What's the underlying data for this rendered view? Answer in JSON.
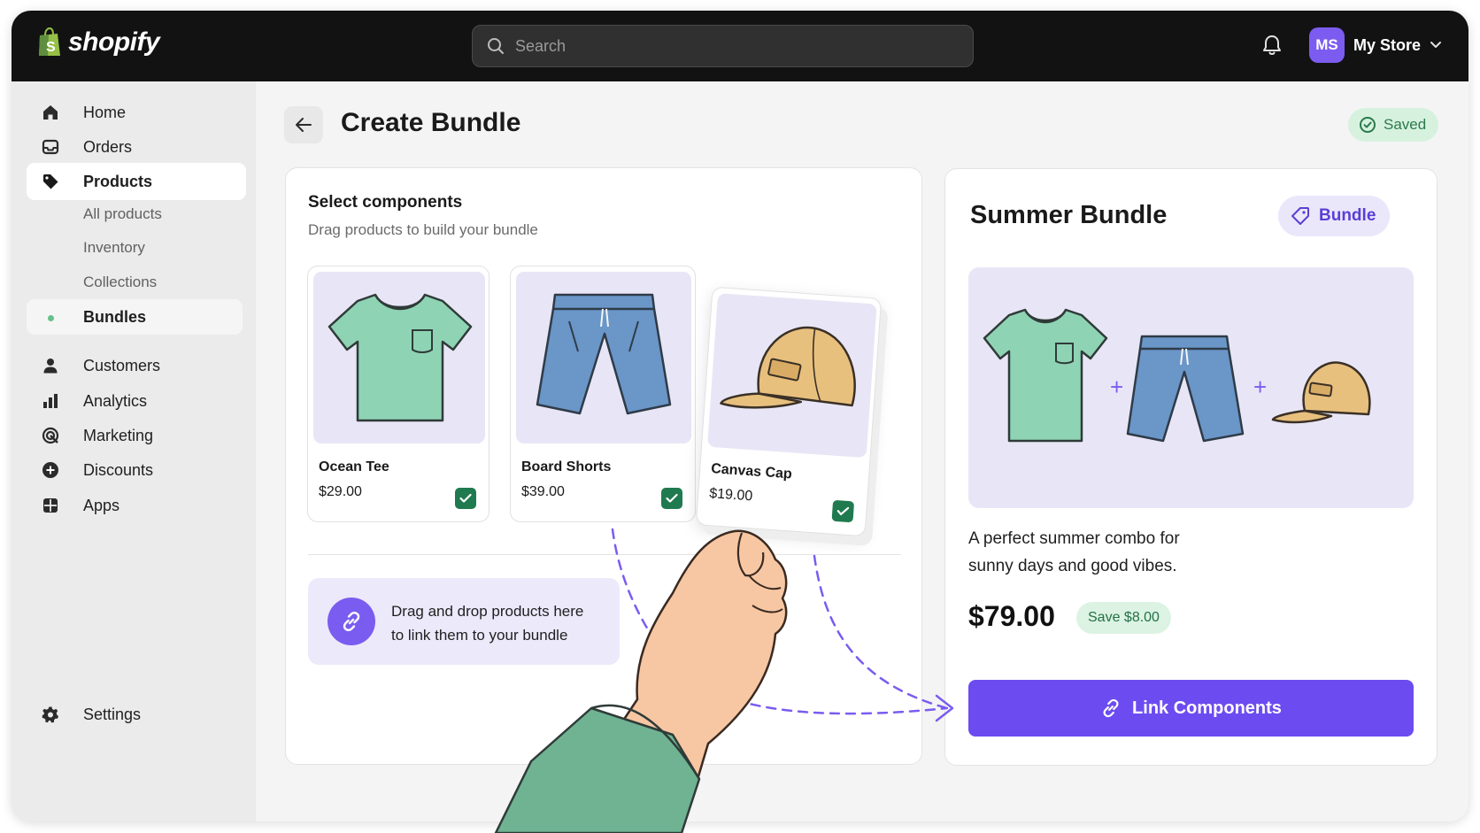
{
  "brand": {
    "name": "shopify",
    "icon": "shopping-bag-logo"
  },
  "search": {
    "placeholder": "Search",
    "icon": "search-icon"
  },
  "header": {
    "notifications_icon": "bell-icon",
    "avatar_initials": "MS",
    "store_name": "My Store",
    "avatar_color": "#7c5cf0"
  },
  "sidebar": {
    "items": [
      {
        "label": "Home",
        "icon": "home-icon"
      },
      {
        "label": "Orders",
        "icon": "inbox-icon"
      },
      {
        "label": "Products",
        "icon": "tag-icon"
      },
      {
        "label": "All products"
      },
      {
        "label": "Inventory"
      },
      {
        "label": "Collections"
      },
      {
        "label": "Bundles"
      },
      {
        "label": "Customers",
        "icon": "person-icon"
      },
      {
        "label": "Analytics",
        "icon": "bar-chart-icon"
      },
      {
        "label": "Marketing",
        "icon": "target-icon"
      },
      {
        "label": "Discounts",
        "icon": "discount-icon"
      },
      {
        "label": "Apps",
        "icon": "apps-icon"
      }
    ],
    "settings": {
      "label": "Settings",
      "icon": "gear-icon"
    }
  },
  "page": {
    "title": "Create Bundle",
    "status": "Saved"
  },
  "components": {
    "title": "Select components",
    "subtitle": "Drag products to build your bundle",
    "products": [
      {
        "name": "Ocean Tee",
        "price": "$29.00",
        "checked": true
      },
      {
        "name": "Board Shorts",
        "price": "$39.00",
        "checked": true
      },
      {
        "name": "Canvas Cap",
        "price": "$19.00",
        "checked": true
      }
    ],
    "drop_zone": {
      "line1": "Drag and drop products here",
      "line2": "to link them to your bundle"
    }
  },
  "bundle": {
    "title": "Summer Bundle",
    "tag": "Bundle",
    "description_line1": "A perfect summer combo for",
    "description_line2": "sunny days and good vibes.",
    "price": "$79.00",
    "savings": "Save $8.00",
    "cta": "Link Components",
    "plus1": "+",
    "plus2": "+"
  },
  "colors": {
    "accent": "#6c4cf0",
    "success": "#1f7a4f",
    "topbar": "#121212",
    "tee": "#8fd3b5",
    "shorts": "#6a96c8",
    "cap": "#e8c07e"
  }
}
